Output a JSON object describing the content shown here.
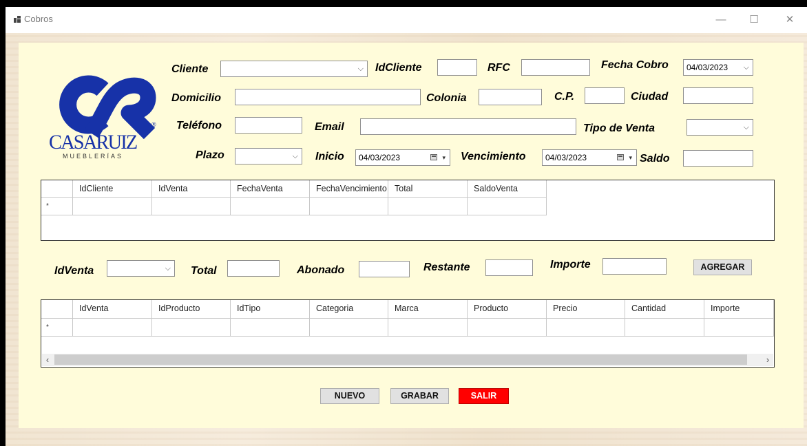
{
  "window": {
    "title": "Cobros",
    "minimize": "—",
    "maximize": "☐",
    "close": "✕"
  },
  "logo": {
    "monogram": "CR",
    "brand": "CASARUIZ",
    "tagline": "MUEBLERÍAS",
    "registered": "®",
    "color": "#1732a8"
  },
  "form": {
    "cliente_label": "Cliente",
    "cliente_value": "",
    "idcliente_label": "IdCliente",
    "idcliente_value": "",
    "rfc_label": "RFC",
    "rfc_value": "",
    "fecha_cobro_label": "Fecha Cobro",
    "fecha_cobro_value": "04/03/2023",
    "domicilio_label": "Domicilio",
    "domicilio_value": "",
    "colonia_label": "Colonia",
    "colonia_value": "",
    "cp_label": "C.P.",
    "cp_value": "",
    "ciudad_label": "Ciudad",
    "ciudad_value": "",
    "telefono_label": "Teléfono",
    "telefono_value": "",
    "email_label": "Email",
    "email_value": "",
    "tipo_venta_label": "Tipo de Venta",
    "tipo_venta_value": "",
    "plazo_label": "Plazo",
    "plazo_value": "",
    "inicio_label": "Inicio",
    "inicio_value": "04/03/2023",
    "vencimiento_label": "Vencimiento",
    "vencimiento_value": "04/03/2023",
    "saldo_label": "Saldo",
    "saldo_value": ""
  },
  "sales_grid": {
    "columns": [
      "IdCliente",
      "IdVenta",
      "FechaVenta",
      "FechaVencimiento",
      "Total",
      "SaldoVenta"
    ],
    "new_row_marker": "*"
  },
  "payment": {
    "idventa_label": "IdVenta",
    "idventa_value": "",
    "total_label": "Total",
    "total_value": "",
    "abonado_label": "Abonado",
    "abonado_value": "",
    "restante_label": "Restante",
    "restante_value": "",
    "importe_label": "Importe",
    "importe_value": "",
    "agregar_label": "AGREGAR"
  },
  "detail_grid": {
    "columns": [
      "IdVenta",
      "IdProducto",
      "IdTipo",
      "Categoria",
      "Marca",
      "Producto",
      "Precio",
      "Cantidad",
      "Importe"
    ],
    "new_row_marker": "*",
    "scroll_left": "‹",
    "scroll_right": "›"
  },
  "actions": {
    "nuevo": "NUEVO",
    "grabar": "GRABAR",
    "salir": "SALIR"
  },
  "icons": {
    "dropdown": "⌵",
    "date_dropdown": "▾"
  }
}
